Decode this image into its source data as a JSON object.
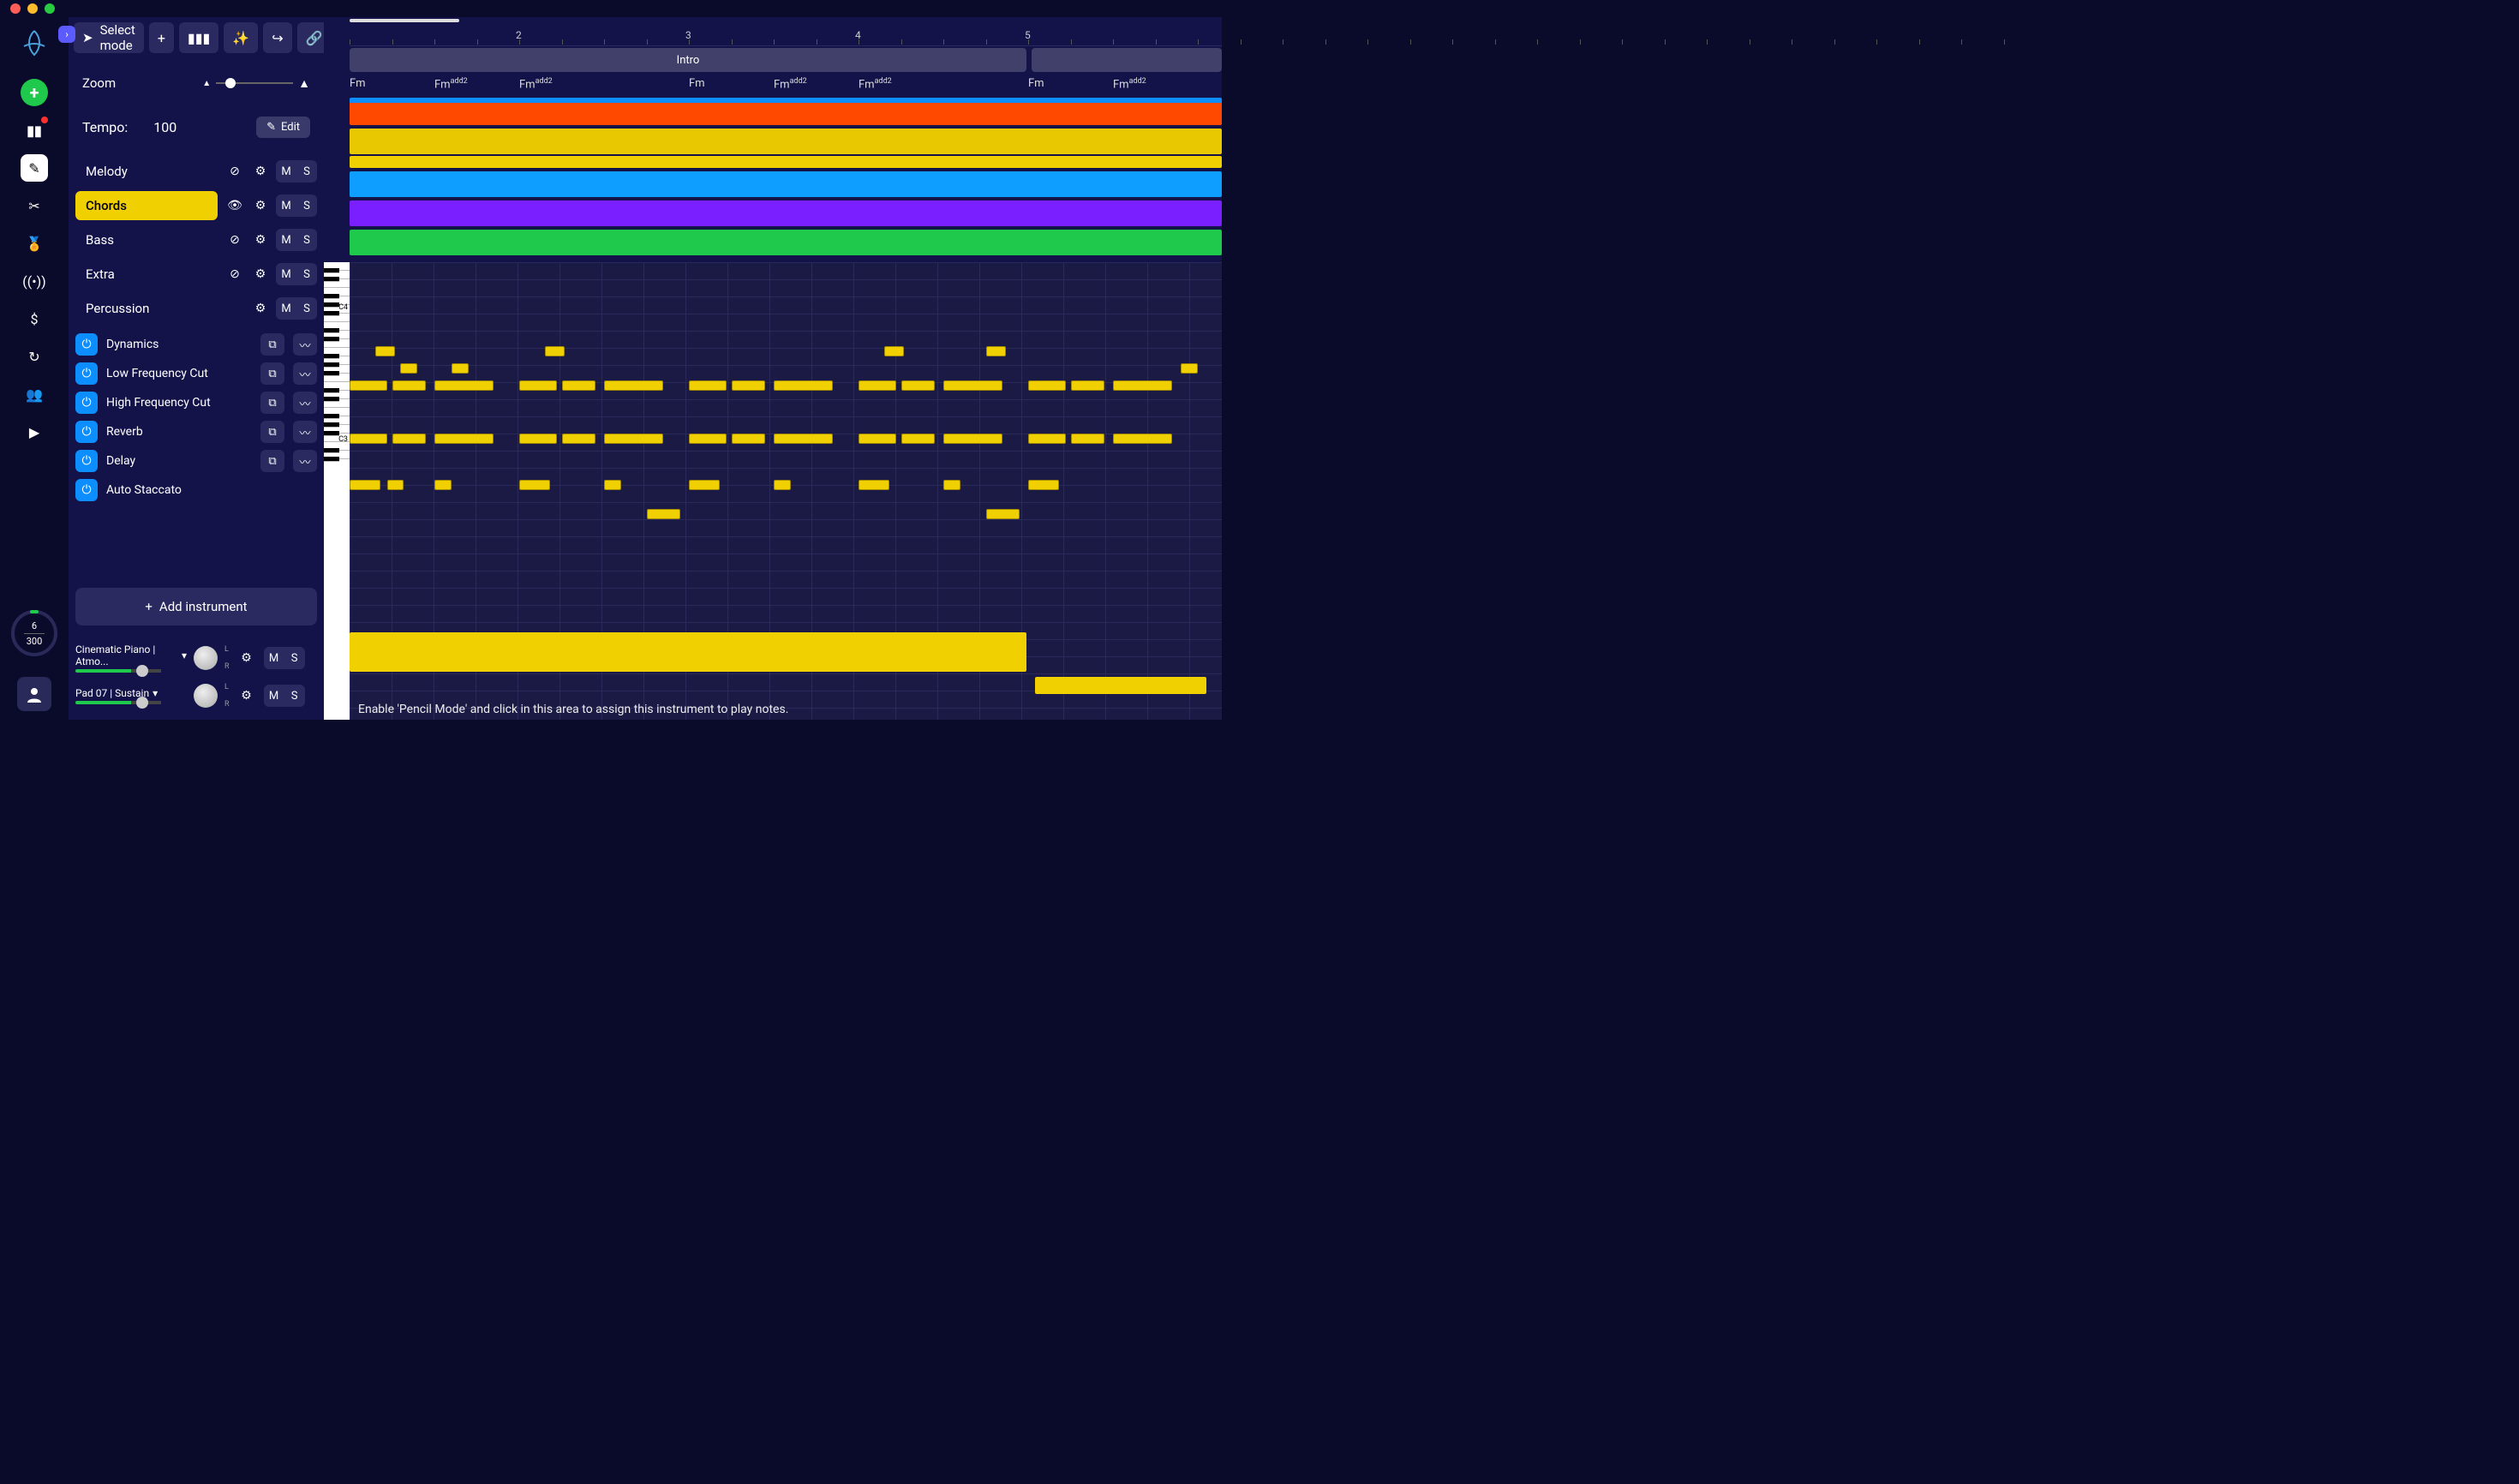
{
  "toolbar": {
    "select_mode": "Select mode"
  },
  "sidebar": {
    "zoom_label": "Zoom",
    "tempo_label": "Tempo:",
    "tempo_value": "100",
    "edit_btn": "Edit",
    "tracks": [
      {
        "name": "Melody",
        "selected": false,
        "has_visibility": true
      },
      {
        "name": "Chords",
        "selected": true,
        "has_visibility": true
      },
      {
        "name": "Bass",
        "selected": false,
        "has_visibility": true
      },
      {
        "name": "Extra",
        "selected": false,
        "has_visibility": true
      },
      {
        "name": "Percussion",
        "selected": false,
        "has_visibility": false
      }
    ],
    "effects": [
      {
        "name": "Dynamics",
        "has_copy": true,
        "has_wave": true
      },
      {
        "name": "Low Frequency Cut",
        "has_copy": true,
        "has_wave": true
      },
      {
        "name": "High Frequency Cut",
        "has_copy": true,
        "has_wave": true
      },
      {
        "name": "Reverb",
        "has_copy": true,
        "has_wave": true
      },
      {
        "name": "Delay",
        "has_copy": true,
        "has_wave": true
      },
      {
        "name": "Auto Staccato",
        "has_copy": false,
        "has_wave": false
      }
    ],
    "add_instrument": "Add instrument",
    "instruments": [
      {
        "name": "Cinematic Piano | Atmo..."
      },
      {
        "name": "Pad 07 | Sustain"
      }
    ],
    "ms": {
      "m": "M",
      "s": "S"
    },
    "lr": {
      "l": "L",
      "r": "R"
    }
  },
  "usage": {
    "used": "6",
    "total": "300"
  },
  "timeline": {
    "bars": [
      "2",
      "3",
      "4",
      "5"
    ],
    "section": "Intro",
    "chords": [
      "Fm",
      "Fmadd2",
      "Fmadd2",
      "Fm",
      "Fmadd2",
      "Fmadd2",
      "Fm",
      "Fmadd2"
    ],
    "piano_labels": {
      "c4": "C4",
      "c3": "C3"
    }
  },
  "hint": "Enable 'Pencil Mode' and click in this area to assign this instrument to play notes.",
  "colors": {
    "melody": "#ff4800",
    "chords": "#f0d000",
    "bass": "#0d9eff",
    "extra": "#7a1fff",
    "percussion": "#1ec94b",
    "accent_blue": "#0d8eff"
  },
  "chart_data": {
    "type": "table",
    "description": "Piano-roll MIDI-style notes for the Chords track (approximate bar positions and pitches read from the grid).",
    "notes_rows": [
      {
        "row": 1,
        "events": [
          {
            "bar": 1.15,
            "len": 0.12
          },
          {
            "bar": 2.15,
            "len": 0.12
          },
          {
            "bar": 4.15,
            "len": 0.12
          },
          {
            "bar": 4.75,
            "len": 0.12
          }
        ]
      },
      {
        "row": 2,
        "events": [
          {
            "bar": 1.3,
            "len": 0.1
          },
          {
            "bar": 1.6,
            "len": 0.1
          },
          {
            "bar": 5.9,
            "len": 0.1
          }
        ]
      },
      {
        "row": 3,
        "events": [
          {
            "bar": 1.0,
            "len": 0.22
          },
          {
            "bar": 1.25,
            "len": 0.2
          },
          {
            "bar": 1.5,
            "len": 0.35
          },
          {
            "bar": 2.0,
            "len": 0.22
          },
          {
            "bar": 2.25,
            "len": 0.2
          },
          {
            "bar": 2.5,
            "len": 0.35
          },
          {
            "bar": 3.0,
            "len": 0.22
          },
          {
            "bar": 3.25,
            "len": 0.2
          },
          {
            "bar": 3.5,
            "len": 0.35
          },
          {
            "bar": 4.0,
            "len": 0.22
          },
          {
            "bar": 4.25,
            "len": 0.2
          },
          {
            "bar": 4.5,
            "len": 0.35
          },
          {
            "bar": 5.0,
            "len": 0.22
          },
          {
            "bar": 5.25,
            "len": 0.2
          },
          {
            "bar": 5.5,
            "len": 0.35
          }
        ]
      },
      {
        "row": 4,
        "events": "same as row 3"
      },
      {
        "row": 5,
        "events": [
          {
            "bar": 1.0,
            "len": 0.18
          },
          {
            "bar": 1.22,
            "len": 0.1
          },
          {
            "bar": 1.5,
            "len": 0.1
          },
          {
            "bar": 2.0,
            "len": 0.18
          },
          {
            "bar": 2.5,
            "len": 0.1
          },
          {
            "bar": 3.0,
            "len": 0.18
          },
          {
            "bar": 3.5,
            "len": 0.1
          },
          {
            "bar": 4.0,
            "len": 0.18
          },
          {
            "bar": 4.5,
            "len": 0.1
          },
          {
            "bar": 5.0,
            "len": 0.18
          }
        ]
      },
      {
        "row": 6,
        "events": [
          {
            "bar": 2.75,
            "len": 0.2
          },
          {
            "bar": 4.75,
            "len": 0.2
          }
        ]
      }
    ],
    "clips": [
      {
        "start_bar": 1.0,
        "end_bar": 5.0
      },
      {
        "start_bar": 5.0,
        "end_bar": 6.0
      }
    ]
  }
}
